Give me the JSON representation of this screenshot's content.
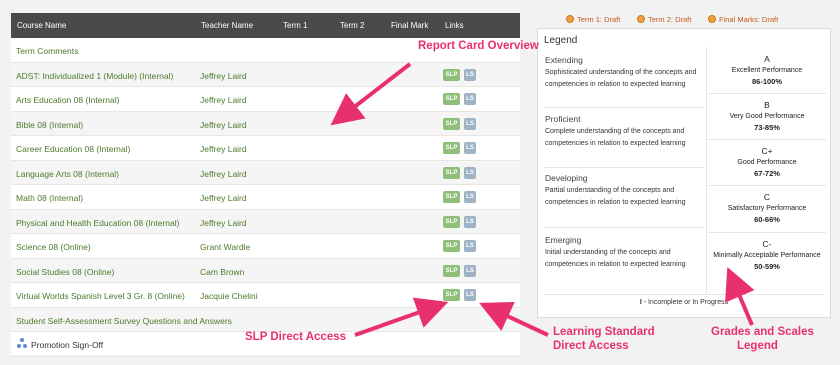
{
  "table": {
    "headers": [
      "Course Name",
      "Teacher Name",
      "Term 1",
      "Term 2",
      "Final Mark",
      "Links"
    ],
    "term_comments": "Term Comments",
    "rows": [
      {
        "course": "ADST: Individualized 1 (Module) (Internal)",
        "teacher": "Jeffrey Laird"
      },
      {
        "course": "Arts Education 08 (Internal)",
        "teacher": "Jeffrey Laird"
      },
      {
        "course": "Bible 08 (Internal)",
        "teacher": "Jeffrey Laird"
      },
      {
        "course": "Career Education 08 (Internal)",
        "teacher": "Jeffrey Laird"
      },
      {
        "course": "Language Arts 08 (Internal)",
        "teacher": "Jeffrey Laird"
      },
      {
        "course": "Math 08 (Internal)",
        "teacher": "Jeffrey Laird"
      },
      {
        "course": "Physical and Health Education 08 (Internal)",
        "teacher": "Jeffrey Laird"
      },
      {
        "course": "Science 08 (Online)",
        "teacher": "Grant Wardle"
      },
      {
        "course": "Social Studies 08 (Online)",
        "teacher": "Cam Brown"
      },
      {
        "course": "Virtual Worlds Spanish Level 3 Gr. 8 (Online)",
        "teacher": "Jacquie Chelini"
      }
    ],
    "slp_label": "SLP",
    "ls_label": "LS",
    "survey": "Student Self-Assessment Survey Questions and Answers",
    "promotion": "Promotion Sign-Off"
  },
  "status": {
    "term1": "Term 1: Draft",
    "term2": "Term 2: Draft",
    "final": "Final Marks: Draft"
  },
  "legend": {
    "title": "Legend",
    "levels": [
      {
        "name": "Extending",
        "desc": "Sophisticated understanding of the concepts and competencies in relation to expected learning"
      },
      {
        "name": "Proficient",
        "desc": "Complete understanding of the concepts and competencies in relation to expected learning"
      },
      {
        "name": "Developing",
        "desc": "Partial understanding of the concepts and competencies in relation to expected learning"
      },
      {
        "name": "Emerging",
        "desc": "Initial understanding of the concepts and competencies in relation to expected learning"
      }
    ],
    "grades": [
      {
        "grade": "A",
        "label": "Excellent Performance",
        "range": "86-100%"
      },
      {
        "grade": "B",
        "label": "Very Good Performance",
        "range": "73-85%"
      },
      {
        "grade": "C+",
        "label": "Good Performance",
        "range": "67-72%"
      },
      {
        "grade": "C",
        "label": "Satisfactory Performance",
        "range": "60-66%"
      },
      {
        "grade": "C-",
        "label": "Minimally Acceptable Performance",
        "range": "50-59%"
      }
    ],
    "incomplete_code": "I",
    "incomplete_text": " - Incomplete or In Progress"
  },
  "annotations": {
    "report_card": "Report Card Overview",
    "slp": "SLP Direct Access",
    "ls_line1": "Learning Standard",
    "ls_line2": "Direct Access",
    "grades_line1": "Grades and Scales",
    "grades_line2": "Legend"
  },
  "colors": {
    "annotation": "#e9306e",
    "link_text": "#4b7a2c",
    "header_bg": "#4a4a4a",
    "slp_badge": "#8fbf79",
    "ls_badge": "#9fb3c7",
    "draft_dot": "#f0a042"
  }
}
